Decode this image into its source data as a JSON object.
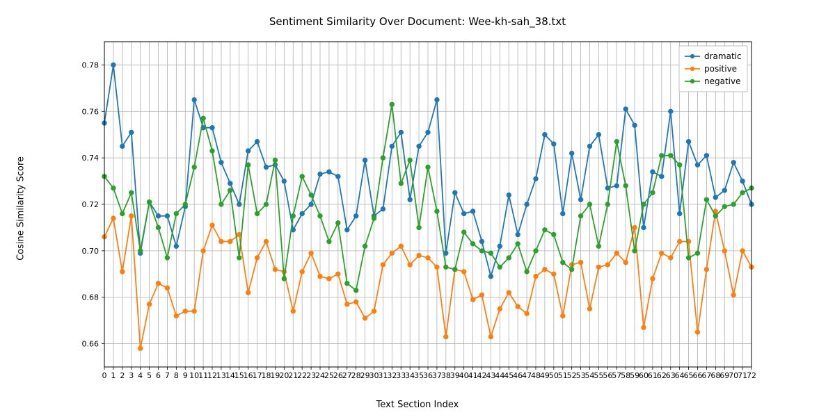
{
  "chart_data": {
    "type": "line",
    "title": "Sentiment Similarity Over Document: Wee-kh-sah_38.txt",
    "xlabel": "Text Section Index",
    "ylabel": "Cosine Similarity Score",
    "x": [
      0,
      1,
      2,
      3,
      4,
      5,
      6,
      7,
      8,
      9,
      10,
      11,
      12,
      13,
      14,
      15,
      16,
      17,
      18,
      19,
      20,
      21,
      22,
      23,
      24,
      25,
      26,
      27,
      28,
      29,
      30,
      31,
      32,
      33,
      34,
      35,
      36,
      37,
      38,
      39,
      40,
      41,
      42,
      43,
      44,
      45,
      46,
      47,
      48,
      49,
      50,
      51,
      52,
      53,
      54,
      55,
      56,
      57,
      58,
      59,
      60,
      61,
      62,
      63,
      64,
      65,
      66,
      67,
      68,
      69,
      70,
      71,
      72
    ],
    "yticks": [
      0.66,
      0.68,
      0.7,
      0.72,
      0.74,
      0.76,
      0.78
    ],
    "ylim": [
      0.65,
      0.79
    ],
    "series": [
      {
        "name": "dramatic",
        "color": "#1f77b4",
        "values": [
          0.755,
          0.78,
          0.745,
          0.751,
          0.699,
          0.721,
          0.715,
          0.715,
          0.702,
          0.719,
          0.765,
          0.753,
          0.753,
          0.738,
          0.729,
          0.72,
          0.743,
          0.747,
          0.736,
          0.737,
          0.73,
          0.709,
          0.716,
          0.72,
          0.733,
          0.734,
          0.732,
          0.709,
          0.715,
          0.739,
          0.715,
          0.718,
          0.745,
          0.751,
          0.722,
          0.745,
          0.751,
          0.765,
          0.699,
          0.725,
          0.716,
          0.717,
          0.704,
          0.689,
          0.702,
          0.724,
          0.707,
          0.72,
          0.731,
          0.75,
          0.746,
          0.716,
          0.742,
          0.722,
          0.745,
          0.75,
          0.727,
          0.728,
          0.761,
          0.754,
          0.71,
          0.734,
          0.732,
          0.76,
          0.716,
          0.747,
          0.737,
          0.741,
          0.723,
          0.726,
          0.738,
          0.73,
          0.72
        ]
      },
      {
        "name": "positive",
        "color": "#ff7f0e",
        "values": [
          0.706,
          0.714,
          0.691,
          0.715,
          0.658,
          0.677,
          0.686,
          0.684,
          0.672,
          0.674,
          0.674,
          0.7,
          0.711,
          0.704,
          0.704,
          0.707,
          0.682,
          0.697,
          0.704,
          0.692,
          0.691,
          0.674,
          0.691,
          0.699,
          0.689,
          0.688,
          0.69,
          0.677,
          0.678,
          0.671,
          0.674,
          0.694,
          0.699,
          0.702,
          0.694,
          0.698,
          0.697,
          0.693,
          0.663,
          0.692,
          0.691,
          0.679,
          0.681,
          0.663,
          0.675,
          0.682,
          0.676,
          0.673,
          0.689,
          0.692,
          0.69,
          0.672,
          0.694,
          0.695,
          0.675,
          0.693,
          0.694,
          0.699,
          0.695,
          0.71,
          0.667,
          0.688,
          0.699,
          0.697,
          0.704,
          0.704,
          0.665,
          0.692,
          0.717,
          0.7,
          0.681,
          0.7,
          0.693
        ]
      },
      {
        "name": "negative",
        "color": "#2ca02c",
        "values": [
          0.732,
          0.727,
          0.716,
          0.725,
          0.7,
          0.721,
          0.71,
          0.697,
          0.716,
          0.72,
          0.736,
          0.757,
          0.743,
          0.72,
          0.726,
          0.697,
          0.737,
          0.716,
          0.72,
          0.739,
          0.688,
          0.715,
          0.732,
          0.724,
          0.715,
          0.704,
          0.712,
          0.686,
          0.683,
          0.702,
          0.714,
          0.74,
          0.763,
          0.729,
          0.739,
          0.71,
          0.736,
          0.717,
          0.693,
          0.692,
          0.708,
          0.703,
          0.7,
          0.699,
          0.693,
          0.697,
          0.703,
          0.691,
          0.7,
          0.709,
          0.707,
          0.695,
          0.692,
          0.715,
          0.72,
          0.702,
          0.72,
          0.747,
          0.728,
          0.7,
          0.72,
          0.725,
          0.741,
          0.741,
          0.737,
          0.697,
          0.699,
          0.722,
          0.715,
          0.719,
          0.72,
          0.725,
          0.727
        ]
      }
    ],
    "legend_position": "upper right"
  }
}
